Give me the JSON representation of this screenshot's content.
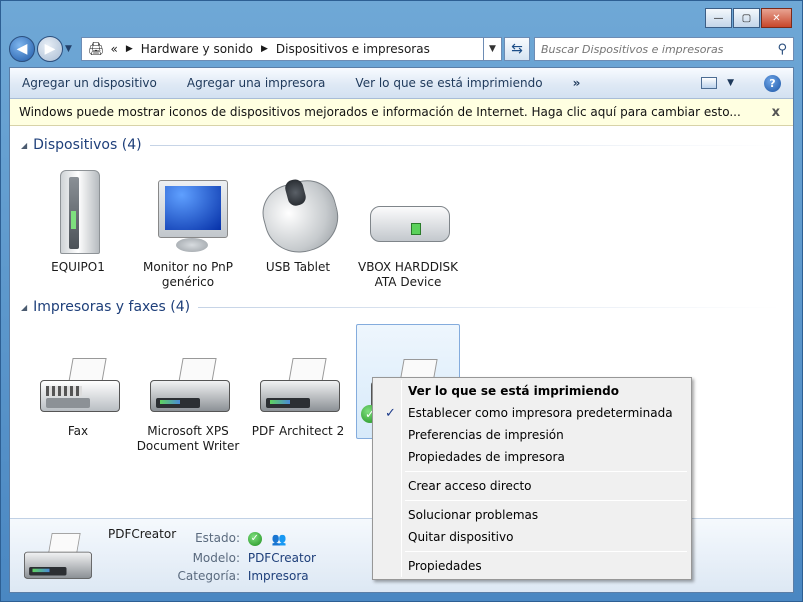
{
  "window": {
    "caption_buttons": {
      "minimize": "—",
      "maximize": "▢",
      "close": "✕"
    }
  },
  "nav": {
    "breadcrumb": [
      "Hardware y sonido",
      "Dispositivos e impresoras"
    ],
    "search_placeholder": "Buscar Dispositivos e impresoras"
  },
  "toolbar": {
    "add_device": "Agregar un dispositivo",
    "add_printer": "Agregar una impresora",
    "see_printing": "Ver lo que se está imprimiendo",
    "more": "»",
    "help": "?"
  },
  "infobar": {
    "text": "Windows puede mostrar iconos de dispositivos mejorados e información de Internet. Haga clic aquí para cambiar esto...",
    "close": "x"
  },
  "groups": {
    "devices": {
      "title": "Dispositivos (4)",
      "items": [
        {
          "label": "EQUIPO1",
          "icon": "computer-icon"
        },
        {
          "label": "Monitor no PnP genérico",
          "icon": "monitor-icon"
        },
        {
          "label": "USB Tablet",
          "icon": "mouse-icon"
        },
        {
          "label": "VBOX HARDDISK ATA Device",
          "icon": "harddisk-icon"
        }
      ]
    },
    "printers": {
      "title": "Impresoras y faxes (4)",
      "items": [
        {
          "label": "Fax",
          "icon": "fax-icon"
        },
        {
          "label": "Microsoft XPS Document Writer",
          "icon": "printer-icon"
        },
        {
          "label": "PDF Architect 2",
          "icon": "printer-icon"
        },
        {
          "label": "",
          "icon": "printer-icon",
          "selected": true,
          "is_default": true
        }
      ]
    }
  },
  "context_menu": {
    "items": [
      {
        "label": "Ver lo que se está imprimiendo",
        "default": true
      },
      {
        "label": "Establecer como impresora predeterminada",
        "checked": true
      },
      {
        "label": "Preferencias de impresión"
      },
      {
        "label": "Propiedades de impresora"
      },
      {
        "separator": true
      },
      {
        "label": "Crear acceso directo"
      },
      {
        "separator": true
      },
      {
        "label": "Solucionar problemas"
      },
      {
        "label": "Quitar dispositivo"
      },
      {
        "separator": true
      },
      {
        "label": "Propiedades"
      }
    ]
  },
  "details": {
    "name": "PDFCreator",
    "status_label": "Estado:",
    "model_label": "Modelo:",
    "model": "PDFCreator",
    "category_label": "Categoría:",
    "category": "Impresora"
  },
  "colors": {
    "accent": "#1e3f7a",
    "infobar_bg": "#ffffe1",
    "selection": "#d7eafa"
  }
}
